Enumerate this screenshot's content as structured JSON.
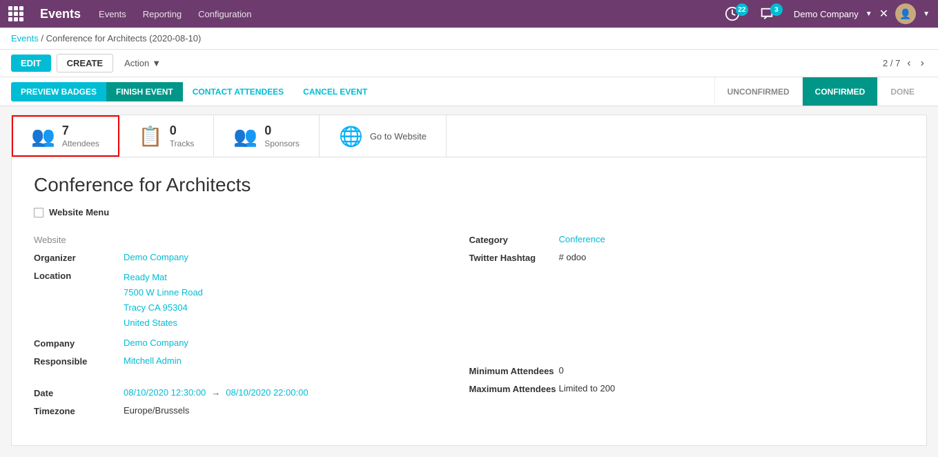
{
  "navbar": {
    "app_name": "Events",
    "menu_items": [
      "Events",
      "Reporting",
      "Configuration"
    ],
    "badge_count_clock": "22",
    "badge_count_chat": "3",
    "company_name": "Demo Company",
    "grid_icon": "grid-icon"
  },
  "breadcrumb": {
    "parent_link": "Events",
    "separator": "/",
    "current_page": "Conference for Architects (2020-08-10)"
  },
  "action_bar": {
    "edit_label": "EDIT",
    "create_label": "CREATE",
    "action_label": "Action",
    "record_position": "2 / 7"
  },
  "button_bar": {
    "preview_badges_label": "PREVIEW BADGES",
    "finish_event_label": "FINISH EVENT",
    "contact_attendees_label": "CONTACT ATTENDEES",
    "cancel_event_label": "CANCEL EVENT",
    "status_unconfirmed": "UNCONFIRMED",
    "status_confirmed": "CONFIRMED",
    "status_done": "DONE"
  },
  "smart_buttons": [
    {
      "id": "attendees",
      "count": "7",
      "label": "Attendees",
      "icon": "people",
      "highlighted": true
    },
    {
      "id": "tracks",
      "count": "0",
      "label": "Tracks",
      "icon": "calendar",
      "highlighted": false
    },
    {
      "id": "sponsors",
      "count": "0",
      "label": "Sponsors",
      "icon": "people",
      "highlighted": false
    },
    {
      "id": "website",
      "count": "",
      "label": "Go to Website",
      "icon": "globe",
      "highlighted": false
    }
  ],
  "form": {
    "event_title": "Conference for Architects",
    "website_menu_label": "Website Menu",
    "left_fields": [
      {
        "label": "Website",
        "value": "",
        "type": "plain"
      },
      {
        "label": "Organizer",
        "value": "Demo Company",
        "type": "link"
      },
      {
        "label": "Location",
        "value": "Ready Mat\n7500 W Linne Road\nTracy CA 95304\nUnited States",
        "type": "link-multi"
      },
      {
        "label": "Company",
        "value": "Demo Company",
        "type": "link"
      },
      {
        "label": "Responsible",
        "value": "Mitchell Admin",
        "type": "link"
      }
    ],
    "right_fields": [
      {
        "label": "Category",
        "value": "Conference",
        "type": "link"
      },
      {
        "label": "Twitter Hashtag",
        "value": "# odoo",
        "type": "plain"
      }
    ],
    "date_label": "Date",
    "date_start": "08/10/2020 12:30:00",
    "date_end": "08/10/2020 22:00:00",
    "timezone_label": "Timezone",
    "timezone_value": "Europe/Brussels",
    "min_attendees_label": "Minimum Attendees",
    "min_attendees_value": "0",
    "max_attendees_label": "Maximum Attendees",
    "max_attendees_value": "Limited to 200"
  }
}
